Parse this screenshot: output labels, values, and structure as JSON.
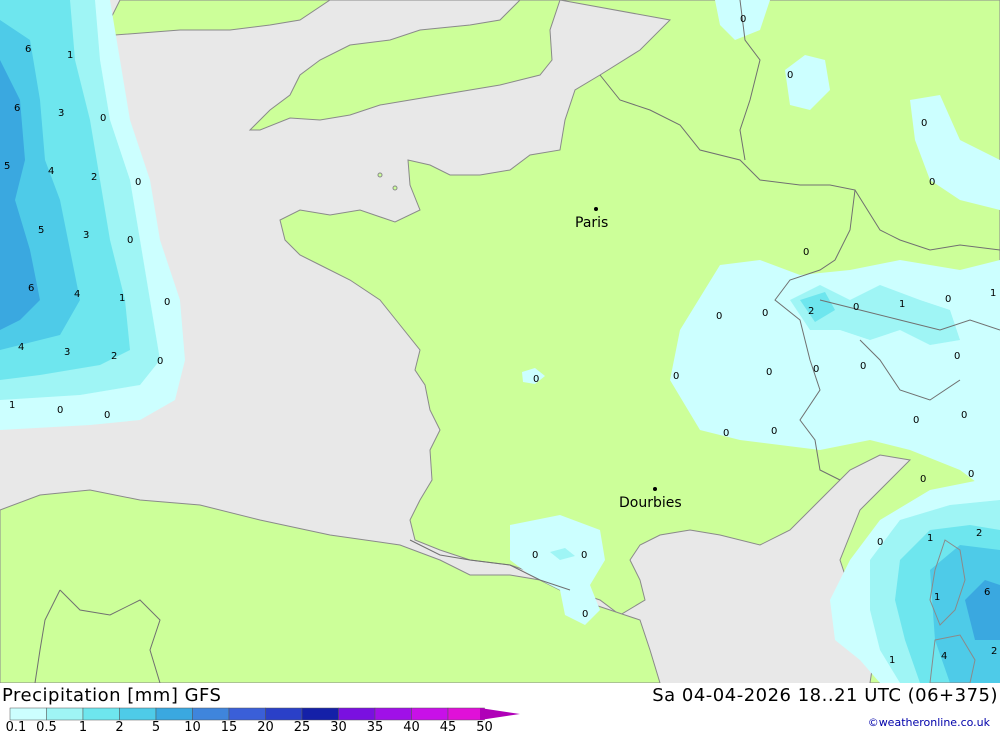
{
  "map": {
    "cities": [
      {
        "name": "Paris"
      },
      {
        "name": "Dourbies"
      }
    ],
    "contour_values": [
      "6",
      "1",
      "6",
      "3",
      "0",
      "5",
      "4",
      "2",
      "0",
      "5",
      "3",
      "0",
      "6",
      "4",
      "1",
      "0",
      "4",
      "3",
      "2",
      "0",
      "1",
      "0",
      "0",
      "0",
      "0",
      "0",
      "0",
      "0",
      "0",
      "2",
      "0",
      "1",
      "0",
      "1",
      "0",
      "0",
      "0",
      "0",
      "0",
      "0",
      "0",
      "0",
      "0",
      "0",
      "0",
      "0",
      "0",
      "0",
      "1",
      "2",
      "0",
      "0",
      "1",
      "6",
      "1",
      "4",
      "2",
      "0"
    ]
  },
  "footer": {
    "title": "Precipitation [mm] GFS",
    "datetime": "Sa 04-04-2026 18..21 UTC (06+375)",
    "credit": "©weatheronline.co.uk"
  },
  "legend": {
    "ticks": [
      "0.1",
      "0.5",
      "1",
      "2",
      "5",
      "10",
      "15",
      "20",
      "25",
      "30",
      "35",
      "40",
      "45",
      "50"
    ],
    "colors": [
      "#ccffff",
      "#9ff5f5",
      "#6ee6ee",
      "#4ecbe8",
      "#3aa8e0",
      "#3f85dc",
      "#3a5fd8",
      "#2a40c8",
      "#1420a8",
      "#7a10e0",
      "#a010e8",
      "#c810e8",
      "#e010d8",
      "#b000b8"
    ]
  },
  "colors": {
    "sea": "#e8e8e8",
    "land": "#ccff99",
    "border": "#707070"
  }
}
